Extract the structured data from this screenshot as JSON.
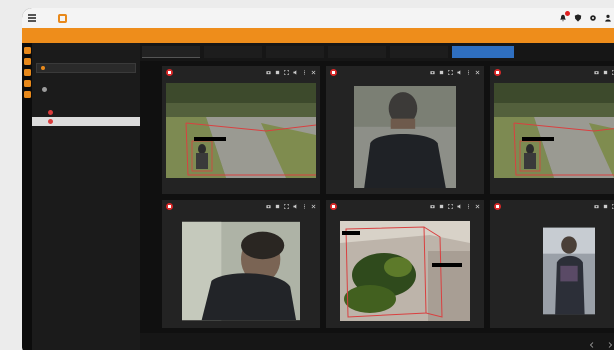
{
  "app": {
    "brand_name": "",
    "window_title": ""
  },
  "topbar": {
    "icons": [
      "menu-icon",
      "bell-icon",
      "shield-icon",
      "gear-icon",
      "user-icon"
    ],
    "alert_badge_color": "#e02020"
  },
  "sidebar": {
    "search_label": "",
    "selector_label": "",
    "section_label": "",
    "tree": [
      {
        "label": "",
        "level": 1
      },
      {
        "label": "",
        "level": 2
      },
      {
        "label": "",
        "level": 2,
        "selected": true
      }
    ]
  },
  "tabs": [
    {
      "label": "",
      "active": true
    },
    {
      "label": ""
    },
    {
      "label": ""
    },
    {
      "label": ""
    },
    {
      "label": ""
    },
    {
      "label": "",
      "highlight": true
    }
  ],
  "tiles": [
    {
      "name": "",
      "scene": "driveway"
    },
    {
      "name": "",
      "scene": "person-back"
    },
    {
      "name": "",
      "scene": "driveway"
    },
    {
      "name": "",
      "scene": "person-face"
    },
    {
      "name": "",
      "scene": "garden"
    },
    {
      "name": "",
      "scene": "person-small"
    }
  ],
  "tile_tools": [
    "camera-icon",
    "record-icon",
    "fullscreen-icon",
    "speaker-icon",
    "more-icon",
    "close-icon"
  ],
  "footer": {
    "pager_text": ""
  },
  "colors": {
    "accent": "#ee8d1b",
    "alert": "#d92828",
    "selected_tab": "#2f6fc0"
  }
}
